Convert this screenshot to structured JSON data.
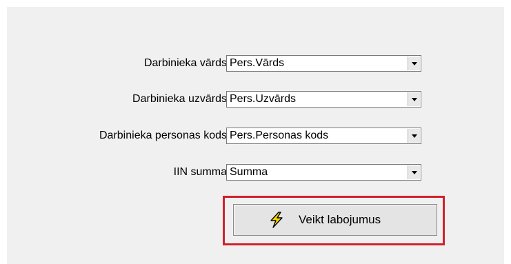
{
  "form": {
    "fields": [
      {
        "label": "Darbinieka vārds",
        "value": "Pers.Vārds"
      },
      {
        "label": "Darbinieka uzvārds",
        "value": "Pers.Uzvārds"
      },
      {
        "label": "Darbinieka personas kods",
        "value": "Pers.Personas kods"
      },
      {
        "label": "IIN summa",
        "value": "Summa"
      }
    ],
    "action_button": {
      "label": "Veikt labojumus",
      "icon": "lightning-icon"
    }
  },
  "colors": {
    "panel_bg": "#f0f0f0",
    "highlight_border": "#d0202a",
    "bolt_fill": "#f5d800"
  }
}
